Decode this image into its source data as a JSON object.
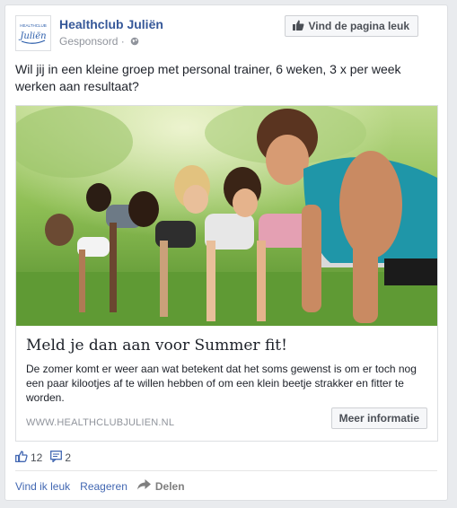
{
  "post": {
    "page_name": "Healthclub Juliën",
    "sponsored_label": "Gesponsord",
    "like_page_label": "Vind de pagina leuk",
    "text": "Wil jij in een kleine groep met personal trainer, 6 weken, 3 x per week werken aan resultaat?",
    "logo": {
      "small_text": "HEALTHCLUB",
      "script_text": "Juliën",
      "color": "#2a5caa"
    }
  },
  "ad": {
    "headline": "Meld je dan aan voor Summer fit!",
    "description": "De zomer komt er weer aan wat betekent dat het soms gewenst is om er toch nog een paar kilootjes af te willen hebben of om een klein beetje strakker en fitter te worden.",
    "display_url": "WWW.HEALTHCLUBJULIEN.NL",
    "cta_label": "Meer informatie",
    "image_icon": "group-plank-exercise-photo"
  },
  "engagement": {
    "likes_count": "12",
    "comments_count": "2"
  },
  "actions": {
    "like_label": "Vind ik leuk",
    "comment_label": "Reageren",
    "share_label": "Delen"
  },
  "colors": {
    "link_blue": "#365899",
    "action_blue": "#4267b2",
    "muted_gray": "#90949c",
    "border": "#dddfe2"
  }
}
